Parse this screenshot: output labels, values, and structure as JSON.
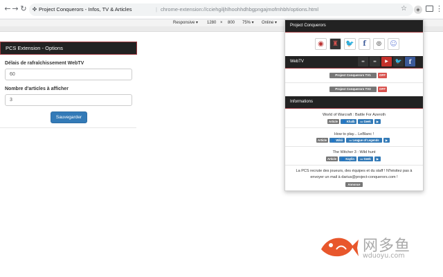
{
  "browser": {
    "back_icon": "back-arrow-icon",
    "forward_icon": "forward-arrow-icon",
    "reload_icon": "reload-icon",
    "site_title": "Project Conquerors - Infos, TV & Articles",
    "separator": "|",
    "url": "chrome-extension://cciehgiljhlhoohhdhbgpngajmofmhbh/options.html",
    "bookmark_icon": "star-icon",
    "extension_icon": "pcs-extension-icon",
    "cast_icon": "cast-icon",
    "menu_icon": "kebab-menu-icon"
  },
  "device_toolbar": {
    "mode": "Responsive ▾",
    "width": "1280",
    "times": "×",
    "height": "800",
    "zoom": "75% ▾",
    "network": "Online ▾"
  },
  "options": {
    "header": "PCS Extension - Options",
    "refresh_label": "Délais de rafraîchissement WebTV",
    "refresh_value": "60",
    "articles_label": "Nombre d'articles à afficher",
    "articles_value": "3",
    "save_label": "Sauvegarder",
    "accent_color": "#337ab7"
  },
  "popup": {
    "header": "Project Conquerors",
    "social_icons": [
      "pcs-logo-icon",
      "team-logo-icon",
      "twitter-icon",
      "facebook-icon",
      "steam-icon",
      "discord-icon"
    ],
    "webtv": {
      "header": "WebTV",
      "buttons": [
        "dailymotion-icon",
        "hitbox-icon",
        "youtube-icon",
        "twitter-icon",
        "facebook-icon"
      ],
      "streams": [
        {
          "name": "Project Conquerors TV1",
          "status": "OFF"
        },
        {
          "name": "Project Conquerors TV2",
          "status": "OFF"
        }
      ]
    },
    "informations": {
      "header": "Informations",
      "items": [
        {
          "title": "World of Warcraft : Battle For Azeroth",
          "type": "Article",
          "author": "Khalb",
          "category": "Geek",
          "play": "▶"
        },
        {
          "title": "How to play... LeBlanc !",
          "type": "Article",
          "author": "Wikii",
          "category": "League of Legends",
          "play": "▶"
        },
        {
          "title": "The Witcher 3 : Wild hunt",
          "type": "Article",
          "author": "Kaylin",
          "category": "Geek",
          "play": "▶"
        }
      ],
      "recruit_text": "La PCS recrute des joueurs, des équipes et du staff ! N'hésitez pas à envoyer un mail à darius@project-conquerors.com !",
      "recruit_tag": "Annonce"
    }
  },
  "watermark": {
    "icon": "fish-logo-icon",
    "cn": "网多鱼",
    "url": "wduoyu.com"
  }
}
